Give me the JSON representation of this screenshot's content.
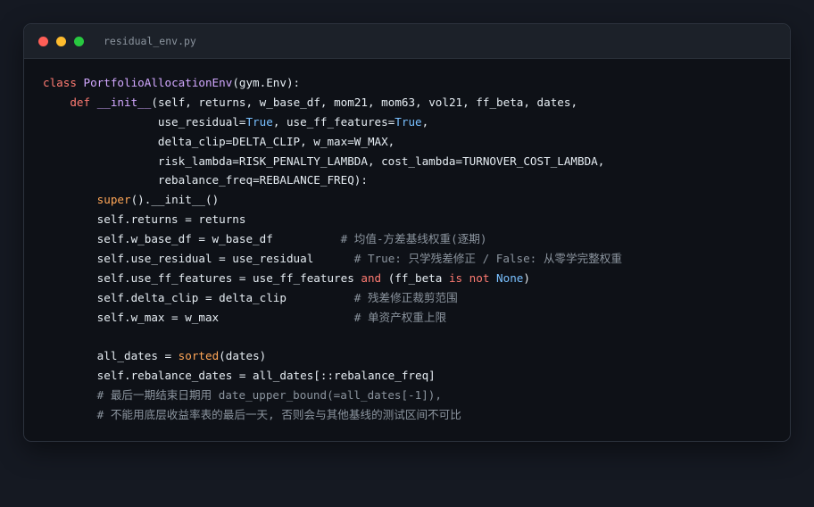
{
  "window": {
    "filename": "residual_env.py",
    "controls": [
      "close",
      "minimize",
      "maximize"
    ]
  },
  "code": {
    "lines": [
      [
        {
          "t": "class ",
          "c": "kw"
        },
        {
          "t": "PortfolioAllocationEnv",
          "c": "cls"
        },
        {
          "t": "(gym.Env):",
          "c": ""
        }
      ],
      [
        {
          "t": "    ",
          "c": ""
        },
        {
          "t": "def ",
          "c": "kw"
        },
        {
          "t": "__init__",
          "c": "fn"
        },
        {
          "t": "(self, returns, w_base_df, mom21, mom63, vol21, ff_beta, dates,",
          "c": ""
        }
      ],
      [
        {
          "t": "                 use_residual=",
          "c": ""
        },
        {
          "t": "True",
          "c": "const"
        },
        {
          "t": ", use_ff_features=",
          "c": ""
        },
        {
          "t": "True",
          "c": "const"
        },
        {
          "t": ",",
          "c": ""
        }
      ],
      [
        {
          "t": "                 delta_clip=DELTA_CLIP, w_max=W_MAX,",
          "c": ""
        }
      ],
      [
        {
          "t": "                 risk_lambda=RISK_PENALTY_LAMBDA, cost_lambda=TURNOVER_COST_LAMBDA,",
          "c": ""
        }
      ],
      [
        {
          "t": "                 rebalance_freq=REBALANCE_FREQ):",
          "c": ""
        }
      ],
      [
        {
          "t": "        ",
          "c": ""
        },
        {
          "t": "super",
          "c": "bi"
        },
        {
          "t": "().__init__()",
          "c": ""
        }
      ],
      [
        {
          "t": "        self.returns = returns",
          "c": ""
        }
      ],
      [
        {
          "t": "        self.w_base_df = w_base_df          ",
          "c": ""
        },
        {
          "t": "# 均值-方差基线权重(逐期)",
          "c": "cm"
        }
      ],
      [
        {
          "t": "        self.use_residual = use_residual      ",
          "c": ""
        },
        {
          "t": "# True: 只学残差修正 / False: 从零学完整权重",
          "c": "cm"
        }
      ],
      [
        {
          "t": "        self.use_ff_features = use_ff_features ",
          "c": ""
        },
        {
          "t": "and",
          "c": "kw"
        },
        {
          "t": " (ff_beta ",
          "c": ""
        },
        {
          "t": "is not",
          "c": "kw"
        },
        {
          "t": " ",
          "c": ""
        },
        {
          "t": "None",
          "c": "const"
        },
        {
          "t": ")",
          "c": ""
        }
      ],
      [
        {
          "t": "        self.delta_clip = delta_clip          ",
          "c": ""
        },
        {
          "t": "# 残差修正裁剪范围",
          "c": "cm"
        }
      ],
      [
        {
          "t": "        self.w_max = w_max                    ",
          "c": ""
        },
        {
          "t": "# 单资产权重上限",
          "c": "cm"
        }
      ],
      [
        {
          "t": "",
          "c": ""
        }
      ],
      [
        {
          "t": "        all_dates = ",
          "c": ""
        },
        {
          "t": "sorted",
          "c": "bi"
        },
        {
          "t": "(dates)",
          "c": ""
        }
      ],
      [
        {
          "t": "        self.rebalance_dates = all_dates[::rebalance_freq]",
          "c": ""
        }
      ],
      [
        {
          "t": "        ",
          "c": ""
        },
        {
          "t": "# 最后一期结束日期用 date_upper_bound(=all_dates[-1]),",
          "c": "cm"
        }
      ],
      [
        {
          "t": "        ",
          "c": ""
        },
        {
          "t": "# 不能用底层收益率表的最后一天, 否则会与其他基线的测试区间不可比",
          "c": "cm"
        }
      ]
    ]
  },
  "colors": {
    "keyword": "#ff7b72",
    "class": "#d2a8ff",
    "builtin": "#ffa657",
    "constant": "#79c0ff",
    "comment": "#8b949e",
    "text": "#e6edf3"
  }
}
